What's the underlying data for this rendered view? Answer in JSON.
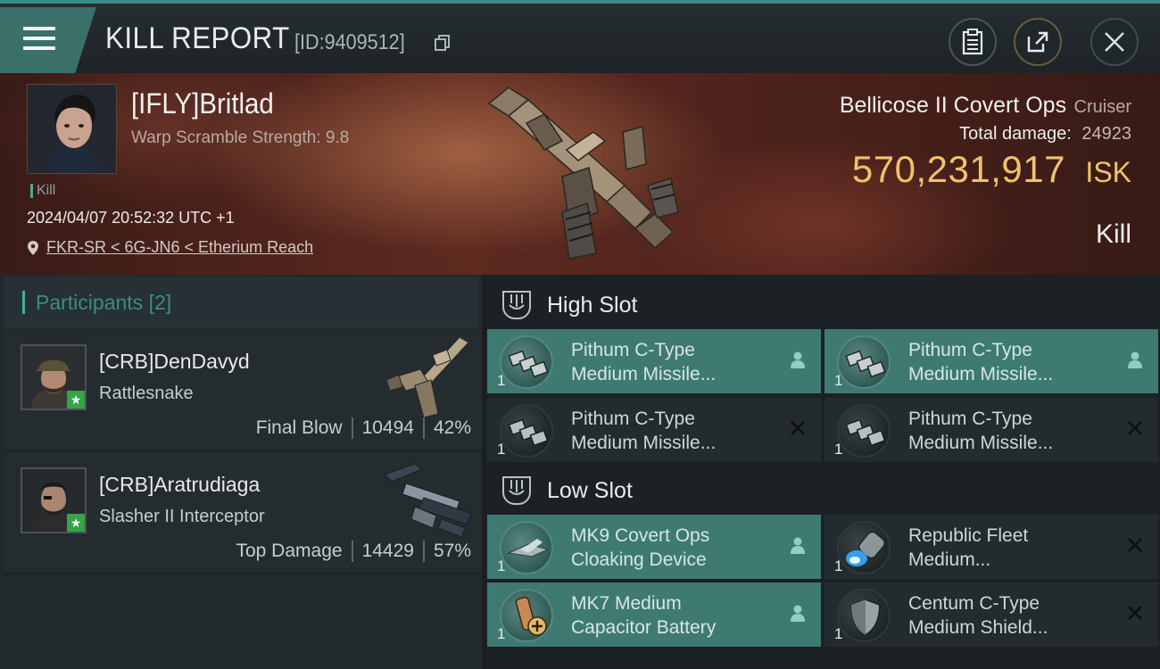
{
  "header": {
    "title": "KILL REPORT",
    "report_id": "[ID:9409512]"
  },
  "victim": {
    "name": "[IFLY]Britlad",
    "warp_scramble": "Warp Scramble Strength: 9.8",
    "kill_tag": "Kill",
    "timestamp": "2024/04/07 20:52:32 UTC +1",
    "location": "FKR-SR < 6G-JN6 < Etherium Reach",
    "ship_name": "Bellicose II Covert Ops",
    "ship_class": "Cruiser",
    "total_damage_label": "Total damage:",
    "total_damage": "24923",
    "isk_value": "570,231,917",
    "isk_unit": "ISK",
    "result": "Kill"
  },
  "participants": {
    "title": "Participants",
    "count": "[2]",
    "rows": [
      {
        "name": "[CRB]DenDavyd",
        "ship": "Rattlesnake",
        "role": "Final Blow",
        "damage": "10494",
        "percent": "42%"
      },
      {
        "name": "[CRB]Aratrudiaga",
        "ship": "Slasher II Interceptor",
        "role": "Top Damage",
        "damage": "14429",
        "percent": "57%"
      }
    ]
  },
  "slots": {
    "high": {
      "title": "High Slot",
      "items": [
        {
          "qty": "1",
          "line1": "Pithum C-Type",
          "line2": "Medium Missile...",
          "state": "dropped",
          "icon": "missile-launcher-icon"
        },
        {
          "qty": "1",
          "line1": "Pithum C-Type",
          "line2": "Medium Missile...",
          "state": "dropped",
          "icon": "missile-launcher-icon"
        },
        {
          "qty": "1",
          "line1": "Pithum C-Type",
          "line2": "Medium Missile...",
          "state": "destroyed",
          "icon": "missile-launcher-icon"
        },
        {
          "qty": "1",
          "line1": "Pithum C-Type",
          "line2": "Medium Missile...",
          "state": "destroyed",
          "icon": "missile-launcher-icon"
        }
      ]
    },
    "low": {
      "title": "Low Slot",
      "items": [
        {
          "qty": "1",
          "line1": "MK9 Covert Ops",
          "line2": "Cloaking Device",
          "state": "dropped",
          "icon": "cloaking-device-icon"
        },
        {
          "qty": "1",
          "line1": "Republic Fleet",
          "line2": "Medium...",
          "state": "destroyed",
          "icon": "thruster-icon"
        },
        {
          "qty": "1",
          "line1": "MK7 Medium",
          "line2": "Capacitor Battery",
          "state": "dropped",
          "icon": "capacitor-battery-icon"
        },
        {
          "qty": "1",
          "line1": "Centum C-Type",
          "line2": "Medium Shield...",
          "state": "destroyed",
          "icon": "shield-icon"
        }
      ]
    }
  },
  "colors": {
    "accent": "#3fb0a4",
    "isk": "#f2c16b",
    "active_item": "#3e7a72"
  }
}
